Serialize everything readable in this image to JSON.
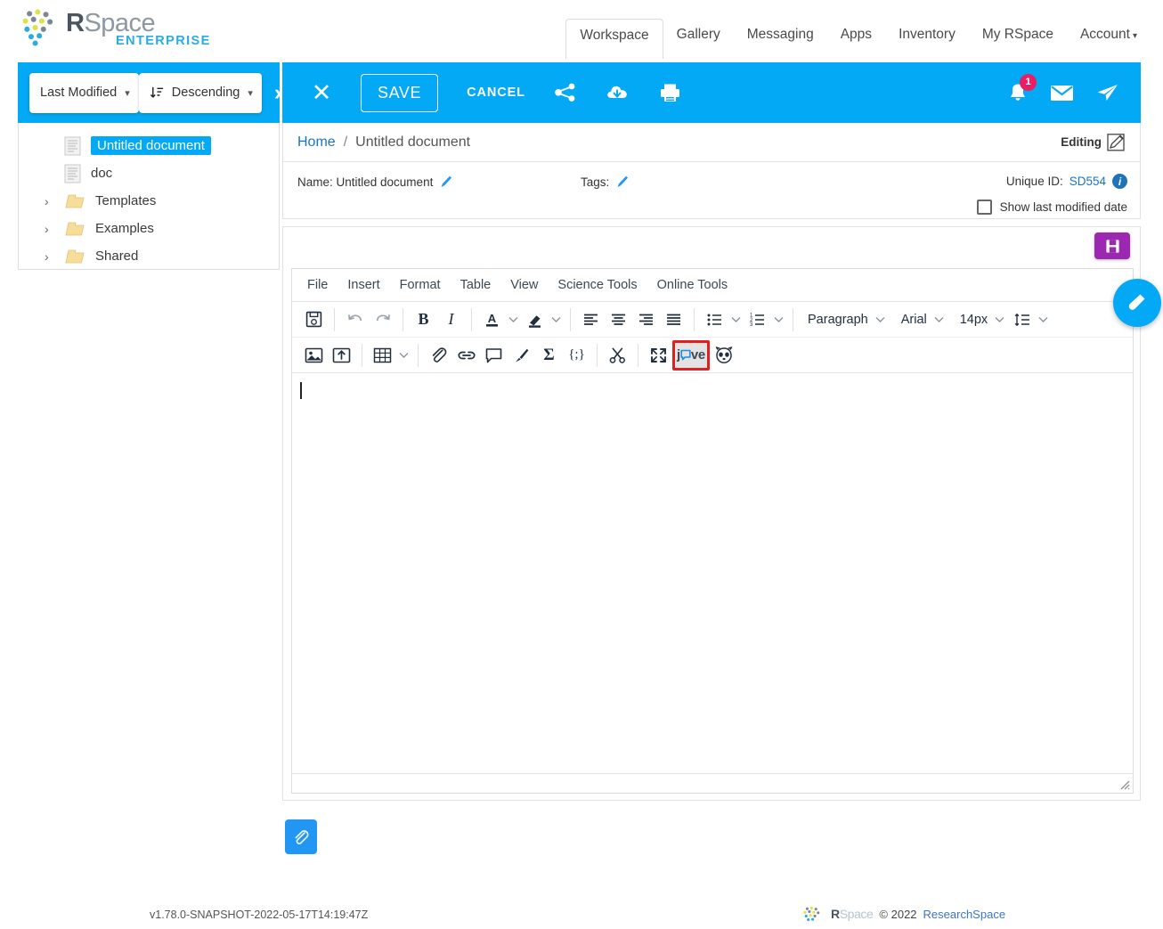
{
  "header": {
    "brand": {
      "r": "R",
      "space": "Space",
      "edition": "ENTERPRISE",
      "logo_icon": "rspace-dots-logo"
    },
    "nav": [
      {
        "label": "Workspace",
        "active": true
      },
      {
        "label": "Gallery",
        "active": false
      },
      {
        "label": "Messaging",
        "active": false
      },
      {
        "label": "Apps",
        "active": false
      },
      {
        "label": "Inventory",
        "active": false
      },
      {
        "label": "My RSpace",
        "active": false
      },
      {
        "label": "Account",
        "active": false,
        "caret": "▾"
      }
    ]
  },
  "sidebar": {
    "sort_field": {
      "label": "Last Modified",
      "caret": "▾"
    },
    "sort_order": {
      "label": "Descending",
      "caret": "▾",
      "icon": "sort-descending-icon"
    },
    "expand_icon": "›",
    "tree": [
      {
        "label": "Untitled document",
        "type": "document",
        "selected": true,
        "chevron": ""
      },
      {
        "label": "doc",
        "type": "document",
        "selected": false,
        "chevron": ""
      },
      {
        "label": "Templates",
        "type": "folder",
        "selected": false,
        "chevron": "›"
      },
      {
        "label": "Examples",
        "type": "folder",
        "selected": false,
        "chevron": "›"
      },
      {
        "label": "Shared",
        "type": "folder",
        "selected": false,
        "chevron": "›"
      }
    ]
  },
  "editor_bar": {
    "close_label": "✕",
    "save_label": "SAVE",
    "cancel_label": "CANCEL",
    "share_icon": "share-nodes-icon",
    "export_icon": "cloud-download-icon",
    "print_icon": "print-icon",
    "notifications_icon": "bell-icon",
    "notifications_count": "1",
    "messages_icon": "envelope-icon",
    "send_icon": "paper-plane-icon",
    "accent_color": "#03a9f4",
    "badge_color": "#e91e63"
  },
  "document": {
    "breadcrumb": {
      "home": "Home",
      "separator": "/",
      "current": "Untitled  document"
    },
    "status_label": "Editing",
    "status_icon": "edit-pencil-icon",
    "name_label": "Name: Untitled document",
    "tags_label": "Tags:",
    "unique_id_label": "Unique ID:",
    "unique_id_value": "SD554",
    "info_icon": "i",
    "show_modified_label": "Show last modified date",
    "show_modified_checked": false
  },
  "editor": {
    "save_icon": "floppy-disk-icon",
    "menus": [
      "File",
      "Insert",
      "Format",
      "Table",
      "View",
      "Science Tools",
      "Online Tools"
    ],
    "toolbar_row1": [
      {
        "name": "save-document-button",
        "icon": "floppy-disk-icon"
      },
      {
        "name": "undo-button",
        "icon": "undo-arrow-icon"
      },
      {
        "name": "redo-button",
        "icon": "redo-arrow-icon"
      },
      {
        "name": "bold-button",
        "icon": "bold-icon",
        "text": "B"
      },
      {
        "name": "italic-button",
        "icon": "italic-icon",
        "text": "I"
      },
      {
        "name": "text-color-button",
        "icon": "text-color-icon",
        "text": "A"
      },
      {
        "name": "text-color-menu",
        "icon": "chevron-down-icon"
      },
      {
        "name": "highlight-color-button",
        "icon": "highlighter-icon"
      },
      {
        "name": "highlight-color-menu",
        "icon": "chevron-down-icon"
      },
      {
        "name": "align-left-button",
        "icon": "align-left-icon"
      },
      {
        "name": "align-center-button",
        "icon": "align-center-icon"
      },
      {
        "name": "align-right-button",
        "icon": "align-right-icon"
      },
      {
        "name": "align-justify-button",
        "icon": "align-justify-icon"
      },
      {
        "name": "bullet-list-button",
        "icon": "bullet-list-icon"
      },
      {
        "name": "bullet-list-menu",
        "icon": "chevron-down-icon"
      },
      {
        "name": "numbered-list-button",
        "icon": "numbered-list-icon"
      },
      {
        "name": "numbered-list-menu",
        "icon": "chevron-down-icon"
      }
    ],
    "block_format": "Paragraph",
    "font_family": "Arial",
    "font_size": "14px",
    "line_height_icon": "line-height-icon",
    "dropdown_caret": "⌄",
    "toolbar_row2": [
      {
        "name": "insert-image-button",
        "icon": "image-icon"
      },
      {
        "name": "insert-from-gallery-button",
        "icon": "upload-box-icon"
      },
      {
        "name": "insert-table-button",
        "icon": "table-icon"
      },
      {
        "name": "table-menu",
        "icon": "chevron-down-icon"
      },
      {
        "name": "attach-file-button",
        "icon": "paperclip-icon"
      },
      {
        "name": "insert-link-button",
        "icon": "link-icon"
      },
      {
        "name": "insert-comment-button",
        "icon": "comment-icon"
      },
      {
        "name": "insert-sketch-button",
        "icon": "paintbrush-icon"
      },
      {
        "name": "insert-equation-button",
        "icon": "sigma-icon"
      },
      {
        "name": "insert-snippet-button",
        "icon": "code-braces-icon"
      },
      {
        "name": "snip-tool-button",
        "icon": "scissors-icon"
      },
      {
        "name": "fullscreen-button",
        "icon": "expand-arrows-icon"
      },
      {
        "name": "jove-button",
        "icon": "jove-logo-icon",
        "label": "jove",
        "active": true
      },
      {
        "name": "protocols-io-button",
        "icon": "raccoon-icon"
      }
    ],
    "content": ""
  },
  "fab": {
    "icon": "test-tube-icon",
    "color": "#03a9f4"
  },
  "attachment_button": {
    "icon": "paperclip-icon",
    "color": "#2196f3"
  },
  "footer": {
    "version": "v1.78.0-SNAPSHOT-2022-05-17T14:19:47Z",
    "brand_r": "R",
    "brand_space": "Space",
    "copyright": "©  2022",
    "company": "ResearchSpace"
  }
}
